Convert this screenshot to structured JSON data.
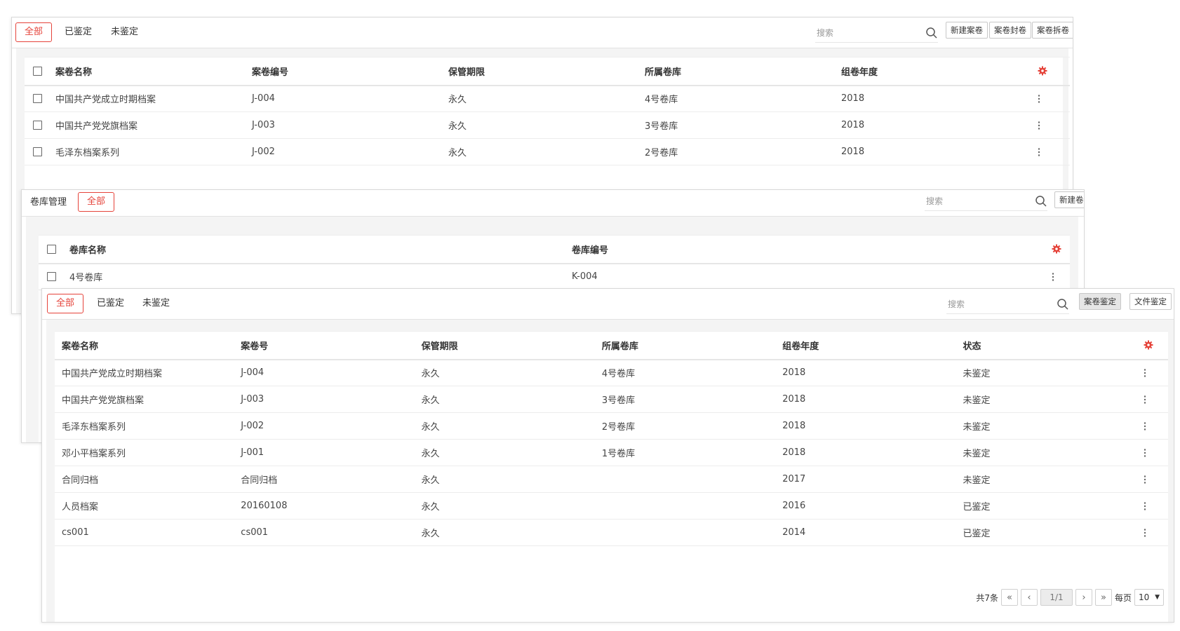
{
  "panel1": {
    "tabs": [
      "全部",
      "已鉴定",
      "未鉴定"
    ],
    "search_placeholder": "搜索",
    "buttons": [
      "新建案卷",
      "案卷封卷",
      "案卷拆卷"
    ],
    "columns": [
      "案卷名称",
      "案卷编号",
      "保管期限",
      "所属卷库",
      "组卷年度"
    ],
    "rows": [
      [
        "中国共产党成立时期档案",
        "J-004",
        "永久",
        "4号卷库",
        "2018"
      ],
      [
        "中国共产党党旗档案",
        "J-003",
        "永久",
        "3号卷库",
        "2018"
      ],
      [
        "毛泽东档案系列",
        "J-002",
        "永久",
        "2号卷库",
        "2018"
      ]
    ]
  },
  "panel2": {
    "title": "卷库管理",
    "tab": "全部",
    "search_placeholder": "搜索",
    "button": "新建卷库",
    "columns": [
      "卷库名称",
      "卷库编号"
    ],
    "rows": [
      [
        "4号卷库",
        "K-004"
      ]
    ]
  },
  "panel3": {
    "tabs": [
      "全部",
      "已鉴定",
      "未鉴定"
    ],
    "search_placeholder": "搜索",
    "buttons": [
      "案卷鉴定",
      "文件鉴定"
    ],
    "columns": [
      "案卷名称",
      "案卷号",
      "保管期限",
      "所属卷库",
      "组卷年度",
      "状态"
    ],
    "rows": [
      [
        "中国共产党成立时期档案",
        "J-004",
        "永久",
        "4号卷库",
        "2018",
        "未鉴定"
      ],
      [
        "中国共产党党旗档案",
        "J-003",
        "永久",
        "3号卷库",
        "2018",
        "未鉴定"
      ],
      [
        "毛泽东档案系列",
        "J-002",
        "永久",
        "2号卷库",
        "2018",
        "未鉴定"
      ],
      [
        "邓小平档案系列",
        "J-001",
        "永久",
        "1号卷库",
        "2018",
        "未鉴定"
      ],
      [
        "合同归档",
        "合同归档",
        "永久",
        "",
        "2017",
        "未鉴定"
      ],
      [
        "人员档案",
        "20160108",
        "永久",
        "",
        "2016",
        "已鉴定"
      ],
      [
        "cs001",
        "cs001",
        "永久",
        "",
        "2014",
        "已鉴定"
      ]
    ],
    "pager": {
      "total": "共7条",
      "first": "«",
      "prev": "‹",
      "page": "1/1",
      "next": "›",
      "last": "»",
      "per_page_label": "每页",
      "per_page": "10"
    }
  },
  "icons": {
    "search": "search-icon",
    "settings": "gear-icon",
    "row_menu": "more-vertical-icon"
  },
  "colors": {
    "accent": "#e5433a",
    "border": "#d9d9d9"
  }
}
